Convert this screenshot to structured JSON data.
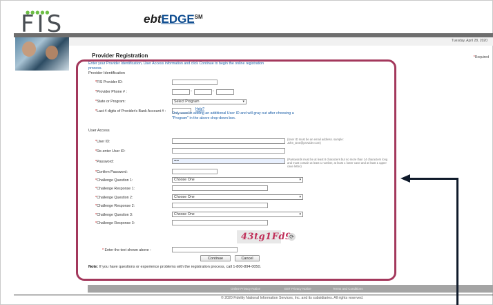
{
  "header": {
    "logo_text": "FIS",
    "brand_ebt": "ebt",
    "brand_edge": "EDGE",
    "brand_sm": "SM",
    "date": "Tuesday, April 28, 2020"
  },
  "page": {
    "title": "Provider Registration",
    "required_note": "Required",
    "intro": "Enter your Provider Identification, User Access information and click Continue to begin the online registration process."
  },
  "provider_id": {
    "section_label": "Provider Identification",
    "fis_provider_id_label": "FIS Provider ID:",
    "phone_label": "Provider Phone # :",
    "phone_dash1": "-",
    "phone_dash2": "-",
    "state_label": "State or Program:",
    "state_value": "Select Program",
    "bank_label": "Last 4 digits of Provider's Bank Account # :",
    "help_link": "Help?",
    "bank_note": "Only used in adding an additional User ID and will gray out after choosing a \"Program\" in the above drop-down box."
  },
  "user_access": {
    "section_label": "User Access",
    "user_id_label": "User ID:",
    "user_id_hint": "(User ID must be an email address. sample: John_Doe@provider.com)",
    "reenter_label": "Re-enter User ID:",
    "password_label": "Password:",
    "password_value": "••••",
    "password_hint": "(Passwords must be at least 8 characters but no more than 14 characters long and must contain at least 1 number, at least 1 lower case and at least 1 upper case letter)",
    "confirm_label": "Confirm Password:",
    "q1_label": "Challenge Question 1:",
    "q1_value": "Choose One",
    "r1_label": "Challenge Response 1:",
    "q2_label": "Challenge Question 2:",
    "q2_value": "Choose One",
    "r2_label": "Challenge Response 2:",
    "q3_label": "Challenge Question 3:",
    "q3_value": "Choose One",
    "r3_label": "Challenge Response 3:"
  },
  "captcha": {
    "text": "43tg1Fd9",
    "prompt": "Enter the text shown above :"
  },
  "actions": {
    "continue": "Continue",
    "cancel": "Cancel"
  },
  "note": {
    "bold": "Note:",
    "text": " If you have questions or experience problems with the registration process, call 1-800-894-0050."
  },
  "footer": {
    "links": [
      "Online Privacy Notice",
      "EBT Privacy Notice",
      "Terms and Conditions"
    ],
    "copyright": "© 2020 Fidelity National Information Services, Inc. and its subsidiaries. All rights reserved."
  },
  "icons": {
    "refresh": "refresh-icon",
    "chevron": "chevron-down-icon"
  },
  "colors": {
    "highlight_border": "#a3385c",
    "link_blue": "#1a5ea8",
    "required_red": "#cc0000",
    "captcha_text": "#c0305a",
    "annotation_arrow": "#0f1a2a"
  }
}
